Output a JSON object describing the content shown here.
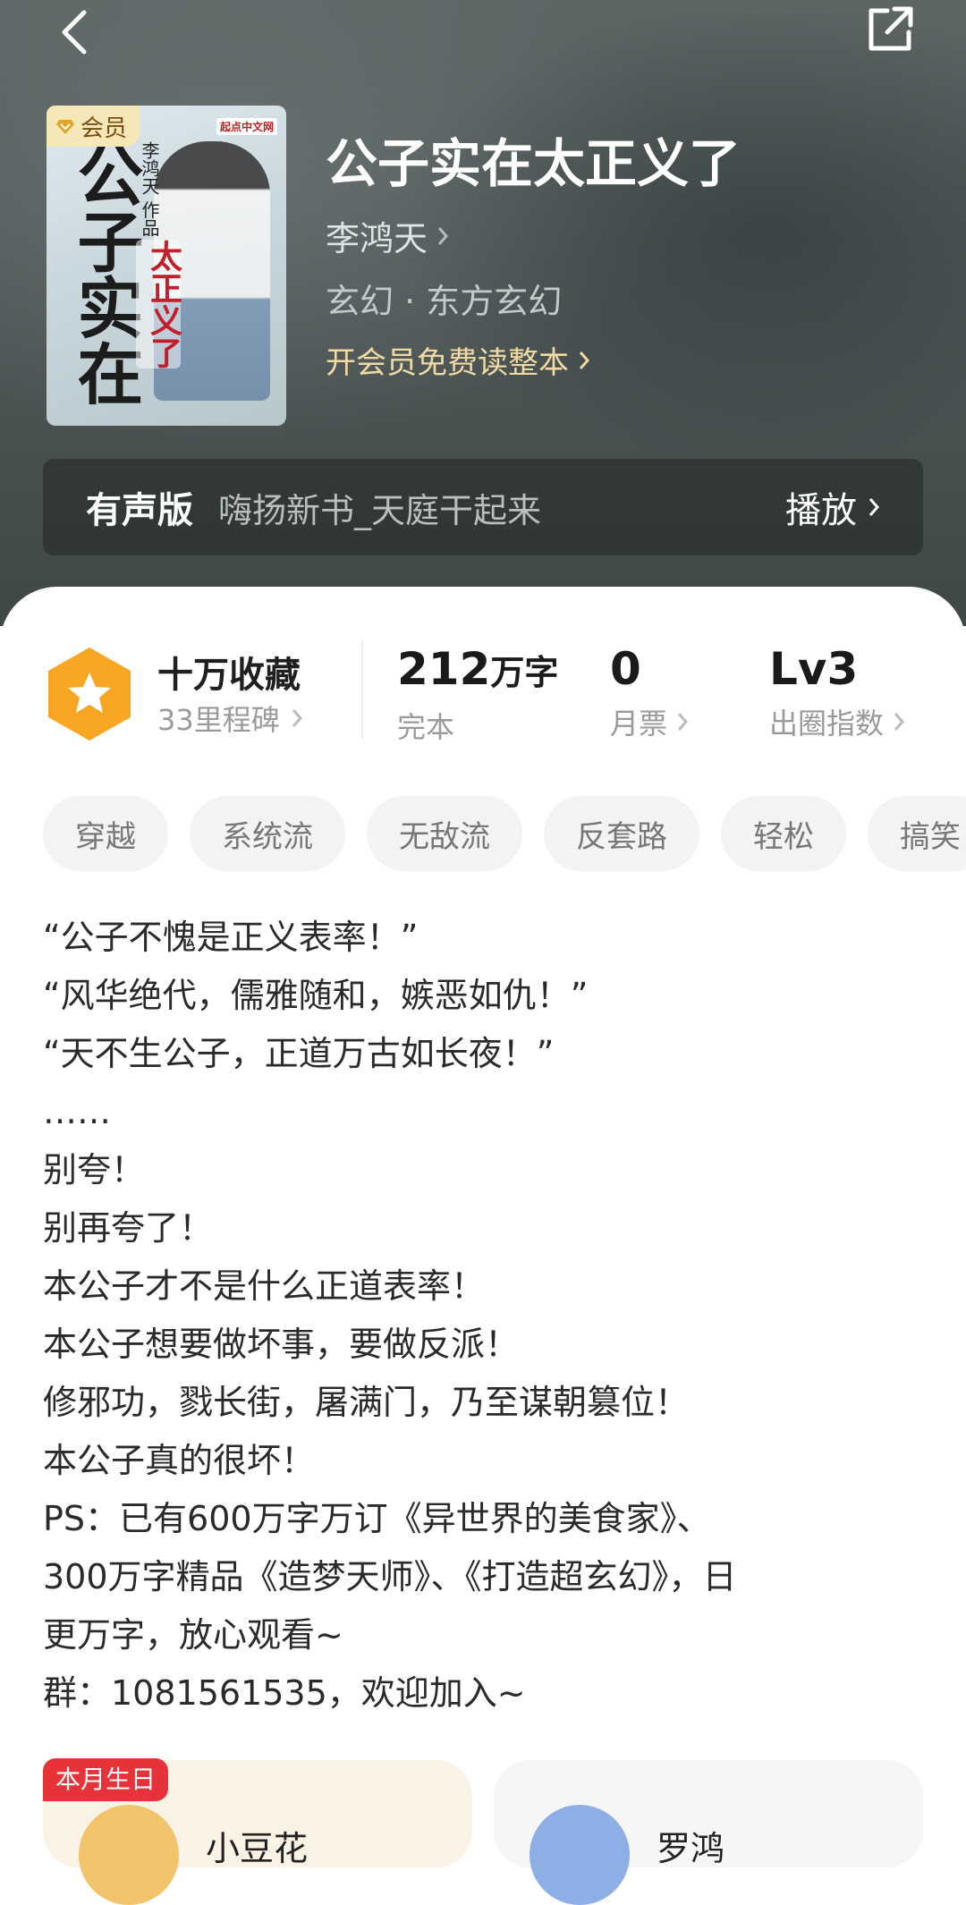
{
  "header": {
    "back_icon": "back-arrow-icon",
    "share_icon": "share-icon"
  },
  "book": {
    "vip_badge": "会员",
    "title": "公子实在太正义了",
    "author": "李鸿天",
    "genre": "玄幻 · 东方玄幻",
    "vip_read_link": "开会员免费读整本"
  },
  "cover_art": {
    "title_text": "公子实在",
    "subtitle_text": "太正义了",
    "author_text": "李鸿天 作品",
    "publisher": "起点中文网"
  },
  "audio": {
    "label": "有声版",
    "name": "嗨扬新书_天庭干起来",
    "play_label": "播放"
  },
  "stats": {
    "favorites": "十万收藏",
    "milestones": "33里程碑",
    "word_count": "212",
    "word_unit": "万字",
    "status": "完本",
    "monthly_votes": "0",
    "monthly_votes_label": "月票",
    "level": "Lv3",
    "level_label": "出圈指数"
  },
  "tags": [
    "穿越",
    "系统流",
    "无敌流",
    "反套路",
    "轻松",
    "搞笑"
  ],
  "description": [
    "“公子不愧是正义表率！”",
    "“风华绝代，儒雅随和，嫉恶如仇！”",
    "“天不生公子，正道万古如长夜！”",
    "……",
    "别夸！",
    "别再夸了！",
    "本公子才不是什么正道表率！",
    "本公子想要做坏事，要做反派！",
    "修邪功，戮长街，屠满门，乃至谋朝篡位！",
    "本公子真的很坏！",
    "PS：已有600万字万订《异世界的美食家》、",
    "300万字精品《造梦天师》、《打造超玄幻》，日",
    "更万字，放心观看~",
    "群：1081561535，欢迎加入~"
  ],
  "fans": [
    {
      "badge": "本月生日",
      "name": "小豆花"
    },
    {
      "badge": "",
      "name": "罗鸿"
    }
  ],
  "colors": {
    "accent_gold": "#f1d9a4",
    "birthday_red": "#e8323a",
    "favorite_orange": "#f6a623"
  }
}
